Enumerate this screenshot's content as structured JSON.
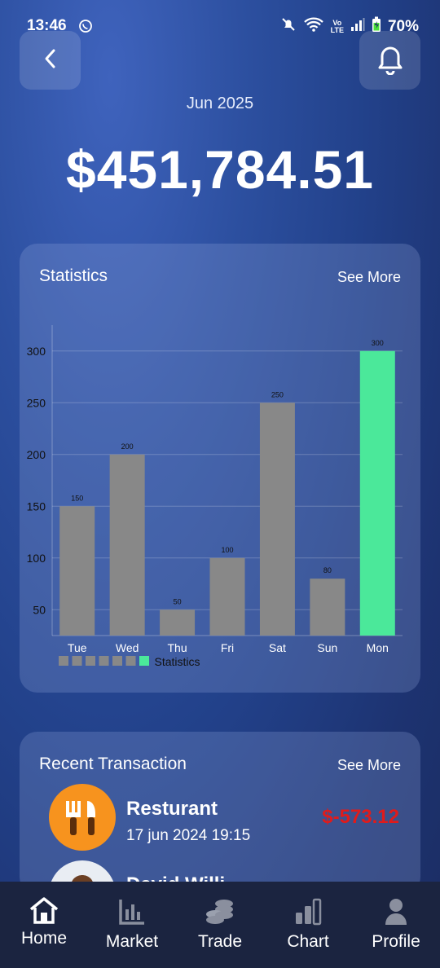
{
  "status_bar": {
    "time": "13:46",
    "battery": "70%",
    "network": "Vo\nLTE"
  },
  "header": {
    "month": "Jun 2025",
    "balance": "$451,784.51"
  },
  "stats": {
    "title": "Statistics",
    "see_more": "See More"
  },
  "chart_data": {
    "type": "bar",
    "categories": [
      "Tue",
      "Wed",
      "Thu",
      "Fri",
      "Sat",
      "Sun",
      "Mon"
    ],
    "values": [
      150,
      200,
      50,
      100,
      250,
      80,
      300
    ],
    "value_labels": [
      "150",
      "200",
      "50",
      "100",
      "250",
      "80",
      "300"
    ],
    "highlight_index": 6,
    "ylim": [
      25,
      325
    ],
    "yticks": [
      50,
      100,
      150,
      200,
      250,
      300
    ],
    "legend": "Statistics",
    "colors": {
      "bar": "#888888",
      "highlight": "#4be89a"
    }
  },
  "transactions": {
    "title": "Recent Transaction",
    "see_more": "See More",
    "items": [
      {
        "name": "Resturant",
        "date": "17 jun 2024 19:15",
        "amount": "$-573.12",
        "icon": "fork-knife-icon"
      },
      {
        "name": "David Willi",
        "icon": "person-avatar"
      }
    ]
  },
  "nav": {
    "items": [
      {
        "label": "Home",
        "icon": "home-icon"
      },
      {
        "label": "Market",
        "icon": "bar-chart-icon"
      },
      {
        "label": "Trade",
        "icon": "coins-icon"
      },
      {
        "label": "Chart",
        "icon": "chart-bars-icon"
      },
      {
        "label": "Profile",
        "icon": "user-icon"
      }
    ]
  }
}
